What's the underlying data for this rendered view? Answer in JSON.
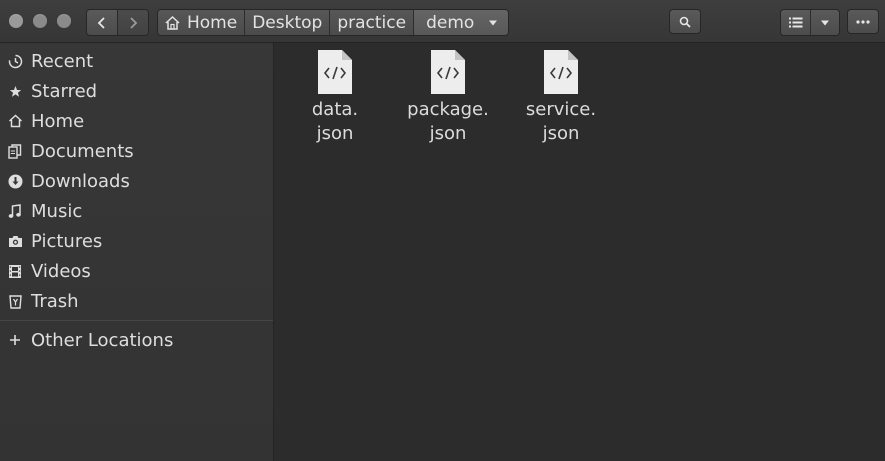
{
  "window": {
    "buttons": [
      "close",
      "minimize",
      "maximize"
    ]
  },
  "header": {
    "back_icon": "chevron-left-icon",
    "forward_icon": "chevron-right-icon",
    "path": [
      {
        "label": "Home",
        "icon": "home-icon"
      },
      {
        "label": "Desktop"
      },
      {
        "label": "practice"
      },
      {
        "label": "demo",
        "icon": "chevron-down-icon"
      }
    ],
    "search_icon": "search-icon",
    "view_icon": "list-view-icon",
    "view_menu_icon": "chevron-down-icon",
    "menu_icon": "more-icon"
  },
  "sidebar": {
    "items": [
      {
        "label": "Recent",
        "icon": "clock-icon"
      },
      {
        "label": "Starred",
        "icon": "star-icon"
      },
      {
        "label": "Home",
        "icon": "home-icon"
      },
      {
        "label": "Documents",
        "icon": "documents-icon"
      },
      {
        "label": "Downloads",
        "icon": "download-icon"
      },
      {
        "label": "Music",
        "icon": "music-icon"
      },
      {
        "label": "Pictures",
        "icon": "camera-icon"
      },
      {
        "label": "Videos",
        "icon": "film-icon"
      },
      {
        "label": "Trash",
        "icon": "trash-icon"
      }
    ],
    "other": {
      "label": "Other Locations",
      "icon": "plus-icon"
    }
  },
  "files": [
    {
      "name": "data.\njson",
      "icon": "code-file-icon"
    },
    {
      "name": "package.\njson",
      "icon": "code-file-icon"
    },
    {
      "name": "service.\njson",
      "icon": "code-file-icon"
    }
  ],
  "colors": {
    "header": "#3a3a3a",
    "sidebar": "#353535",
    "content": "#2c2c2c",
    "text": "#dedede"
  }
}
